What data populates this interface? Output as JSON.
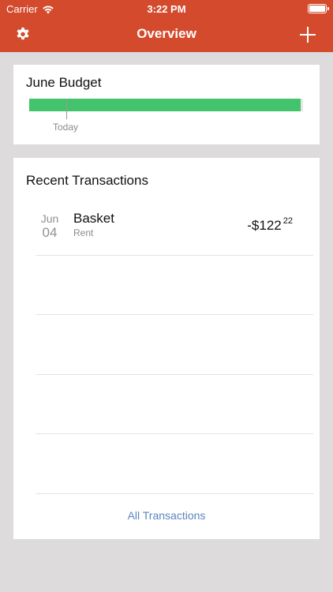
{
  "status_bar": {
    "carrier": "Carrier",
    "time": "3:22 PM"
  },
  "nav": {
    "title": "Overview",
    "left_icon": "gear-icon",
    "right_icon": "plus-icon"
  },
  "budget": {
    "title": "June Budget",
    "today_label": "Today",
    "spent_fraction": 0.99,
    "bar_color": "#43c46c"
  },
  "transactions": {
    "title": "Recent Transactions",
    "items": [
      {
        "month": "Jun",
        "day": "04",
        "name": "Basket",
        "category": "Rent",
        "amount_main": "-$122",
        "amount_cents": "22"
      }
    ],
    "all_link": "All Transactions"
  },
  "colors": {
    "accent": "#d34b2c",
    "link": "#5b85c0",
    "background": "#dddbdc"
  }
}
